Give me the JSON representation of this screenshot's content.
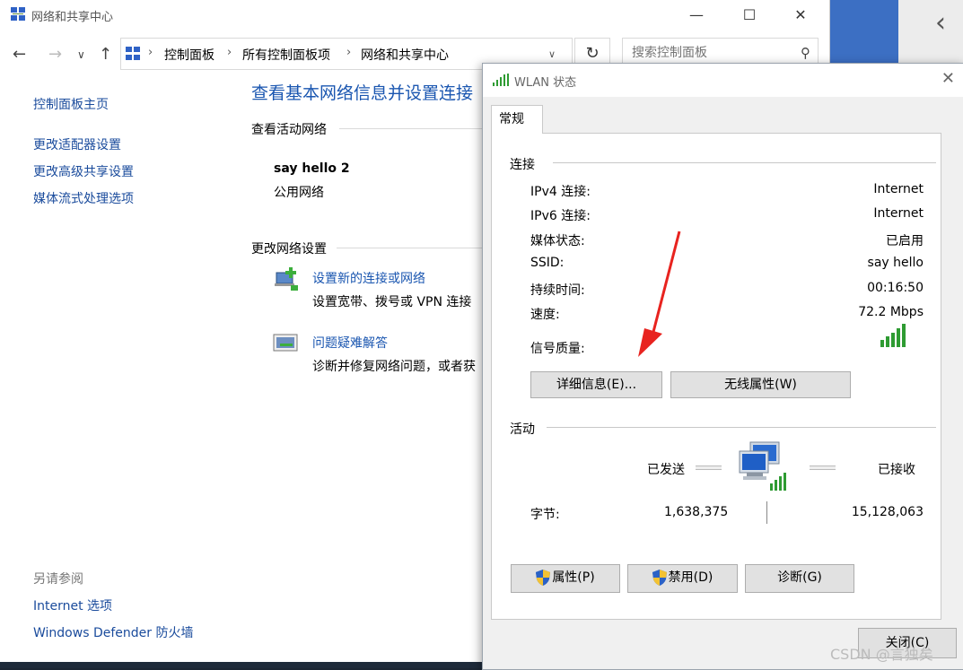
{
  "main_window": {
    "title": "网络和共享中心",
    "controls": {
      "minimize": "—",
      "maximize": "☐",
      "close": "✕"
    },
    "breadcrumb": [
      "控制面板",
      "所有控制面板项",
      "网络和共享中心"
    ],
    "search_placeholder": "搜索控制面板",
    "sidebar": {
      "items": [
        "控制面板主页",
        "更改适配器设置",
        "更改高级共享设置",
        "媒体流式处理选项"
      ],
      "see_also_label": "另请参阅",
      "see_also": [
        "Internet 选项",
        "Windows Defender 防火墙"
      ]
    },
    "heading": "查看基本网络信息并设置连接",
    "active_networks_label": "查看活动网络",
    "network_name": "say hello 2",
    "network_type": "公用网络",
    "change_settings_label": "更改网络设置",
    "tasks": [
      {
        "link": "设置新的连接或网络",
        "desc": "设置宽带、拨号或 VPN 连接"
      },
      {
        "link": "问题疑难解答",
        "desc": "诊断并修复网络问题，或者获"
      }
    ]
  },
  "wlan_dialog": {
    "title": "WLAN 状态",
    "tab": "常规",
    "connection_label": "连接",
    "rows": [
      {
        "key": "IPv4 连接:",
        "value": "Internet"
      },
      {
        "key": "IPv6 连接:",
        "value": "Internet"
      },
      {
        "key": "媒体状态:",
        "value": "已启用"
      },
      {
        "key": "SSID:",
        "value": "say hello"
      },
      {
        "key": "持续时间:",
        "value": "00:16:50"
      },
      {
        "key": "速度:",
        "value": "72.2 Mbps"
      }
    ],
    "signal_label": "信号质量:",
    "signal_bars": 5,
    "details_button": "详细信息(E)...",
    "wireless_props_button": "无线属性(W)",
    "activity_label": "活动",
    "sent_label": "已发送",
    "received_label": "已接收",
    "bytes_label": "字节:",
    "bytes_sent": "1,638,375",
    "bytes_received": "15,128,063",
    "properties_button": "属性(P)",
    "disable_button": "禁用(D)",
    "diagnose_button": "诊断(G)",
    "close_button": "关闭(C)"
  },
  "watermark": "CSDN @言独矣",
  "colors": {
    "link": "#1a56b0",
    "signal": "#2e9b32",
    "annotation_arrow": "#e8231f"
  }
}
